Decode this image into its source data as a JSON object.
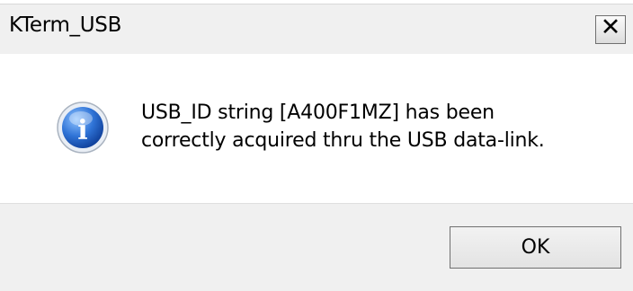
{
  "window": {
    "title": "KTerm_USB",
    "close_label": "✕"
  },
  "message": {
    "line1": "USB_ID string [A400F1MZ] has been",
    "line2": "correctly acquired thru the USB data-link."
  },
  "icon": {
    "type": "information-icon",
    "glyph": "i"
  },
  "buttons": {
    "ok_label": "OK"
  },
  "colors": {
    "titlebar_bg": "#f0f0f0",
    "content_bg": "#ffffff",
    "footer_bg": "#f0f0f0",
    "info_blue": "#2b6fd6"
  }
}
